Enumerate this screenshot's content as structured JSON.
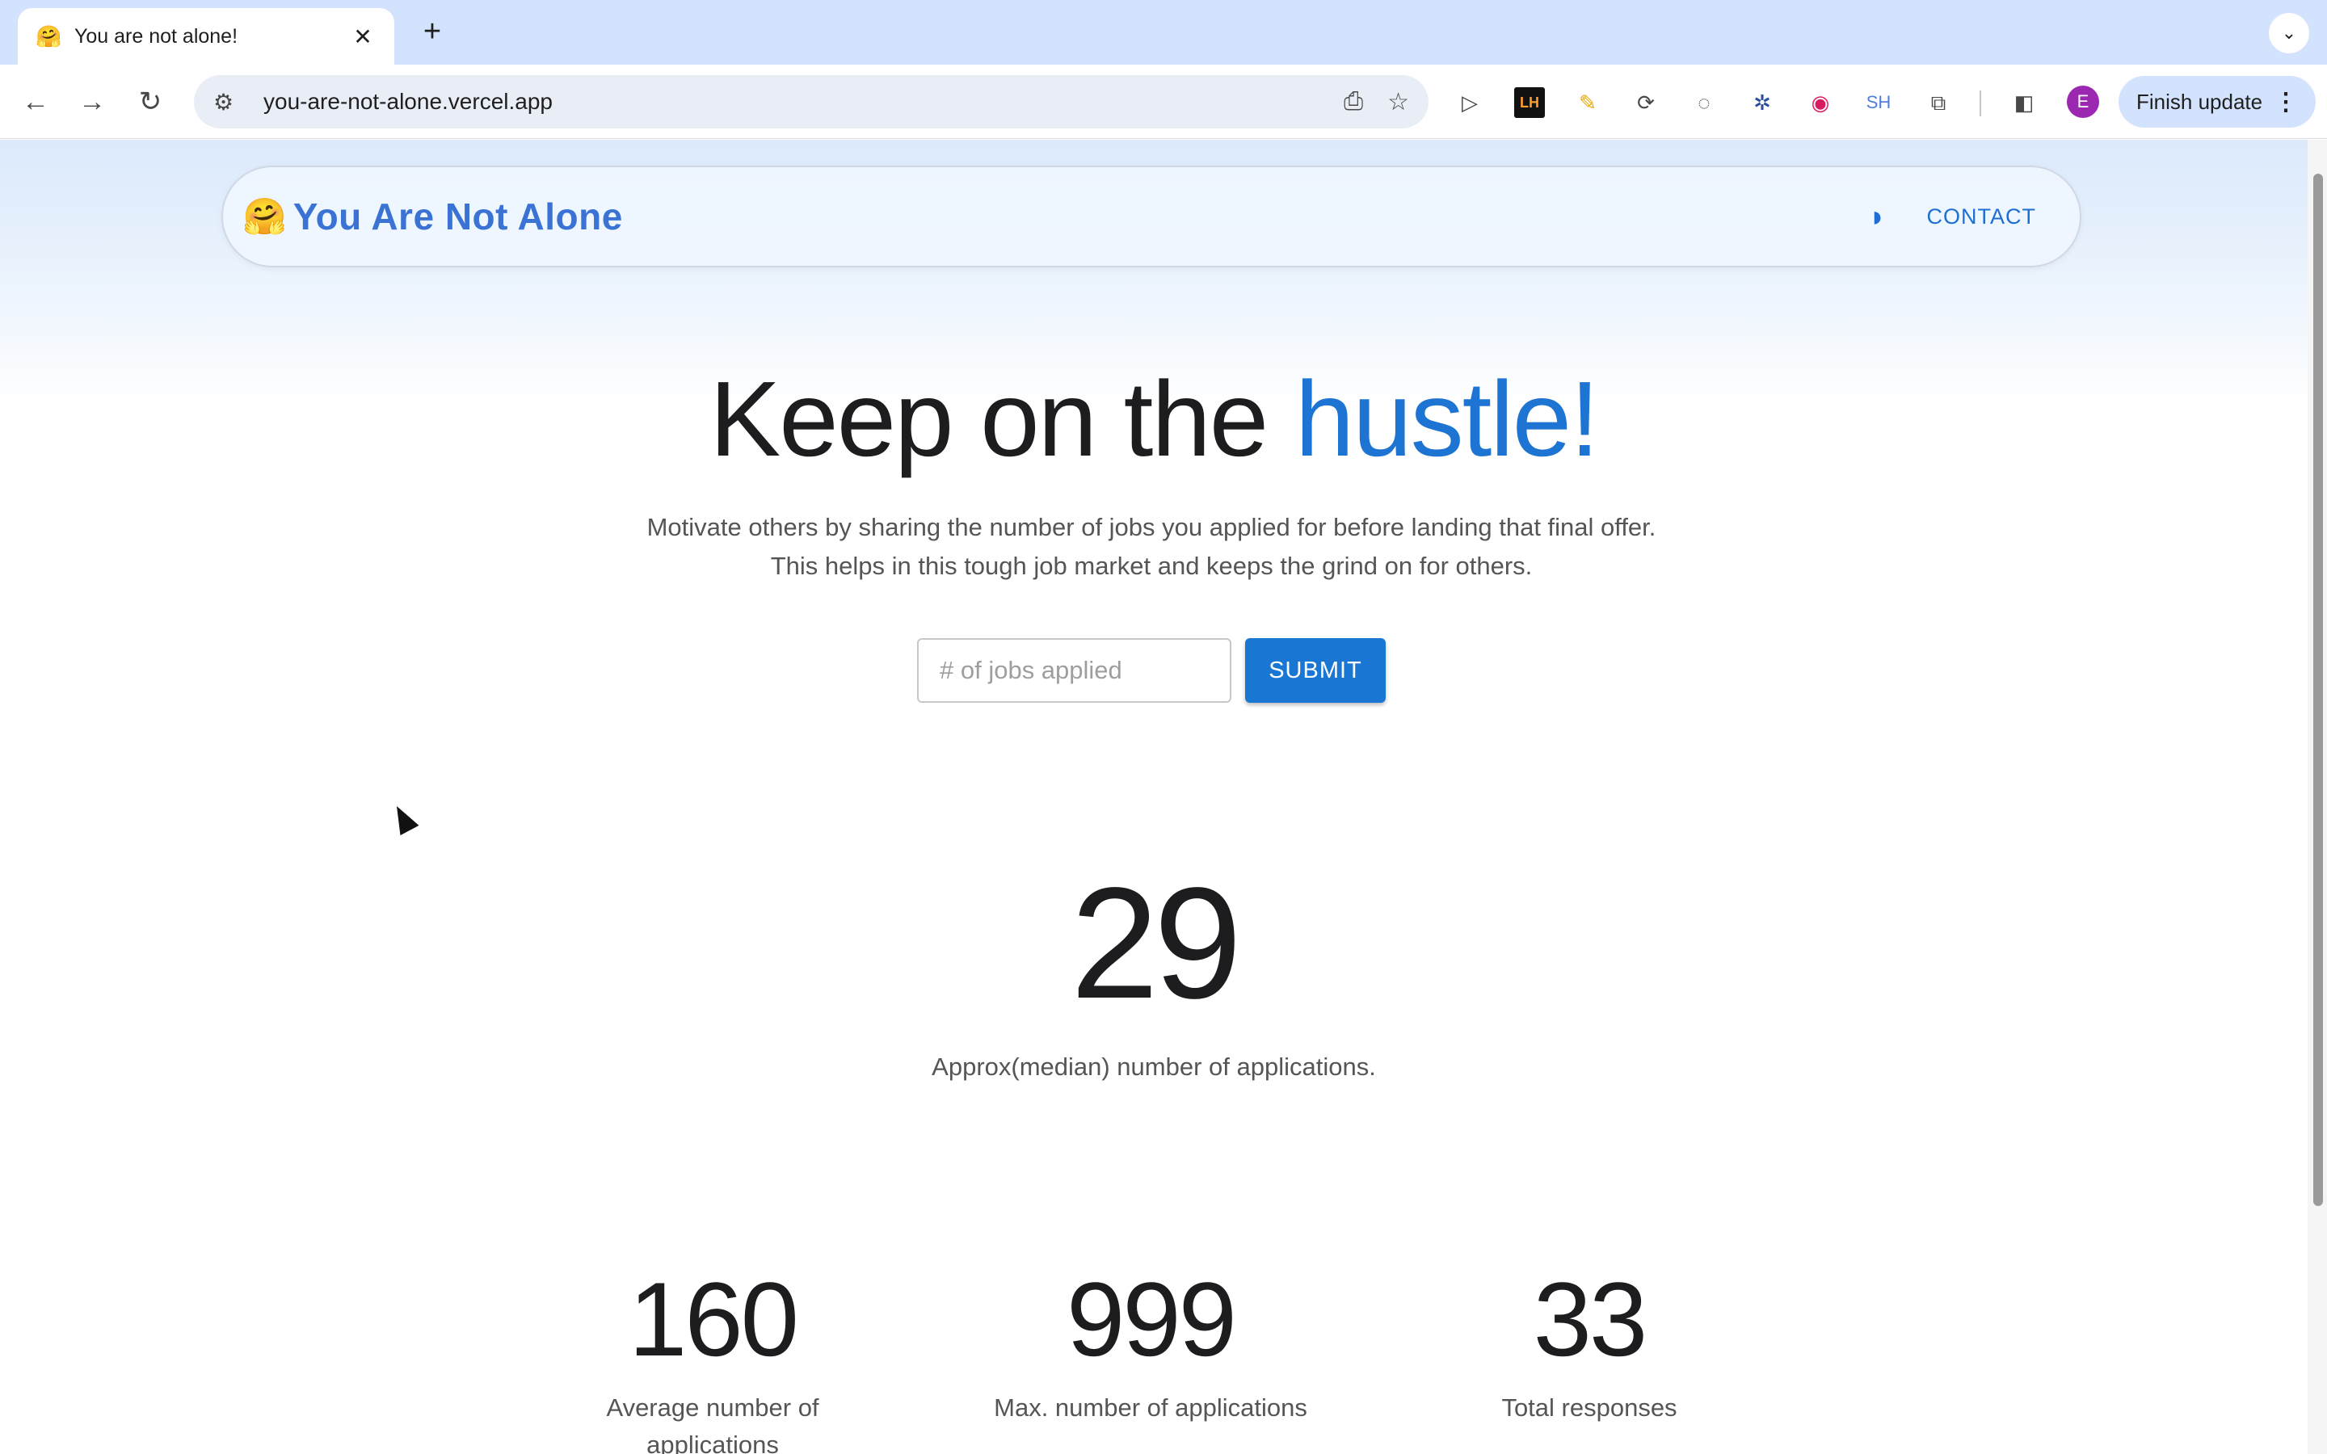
{
  "browser": {
    "tab_title": "You are not alone!",
    "tab_favicon": "🤗",
    "url": "you-are-not-alone.vercel.app",
    "finish_update_label": "Finish update",
    "profile_initial": "E",
    "ext_lh_label": "LH",
    "ext_sh_label": "SH"
  },
  "navbar": {
    "brand_emoji": "🤗",
    "brand": "You Are Not Alone",
    "contact": "CONTACT"
  },
  "hero": {
    "title_prefix": "Keep on the ",
    "title_accent": "hustle!",
    "subtitle": "Motivate others by sharing the number of jobs you applied for before landing that final offer. This helps in this tough job market and keeps the grind on for others."
  },
  "form": {
    "placeholder": "# of jobs applied",
    "submit_label": "SUBMIT"
  },
  "stats": {
    "median_value": "29",
    "median_label": "Approx(median) number of applications.",
    "items": [
      {
        "value": "160",
        "label": "Average number of applications"
      },
      {
        "value": "999",
        "label": "Max. number of applications"
      },
      {
        "value": "33",
        "label": "Total responses"
      }
    ]
  },
  "colors": {
    "accent": "#1e74d2",
    "brand": "#3b73d4",
    "button": "#1976d2"
  }
}
